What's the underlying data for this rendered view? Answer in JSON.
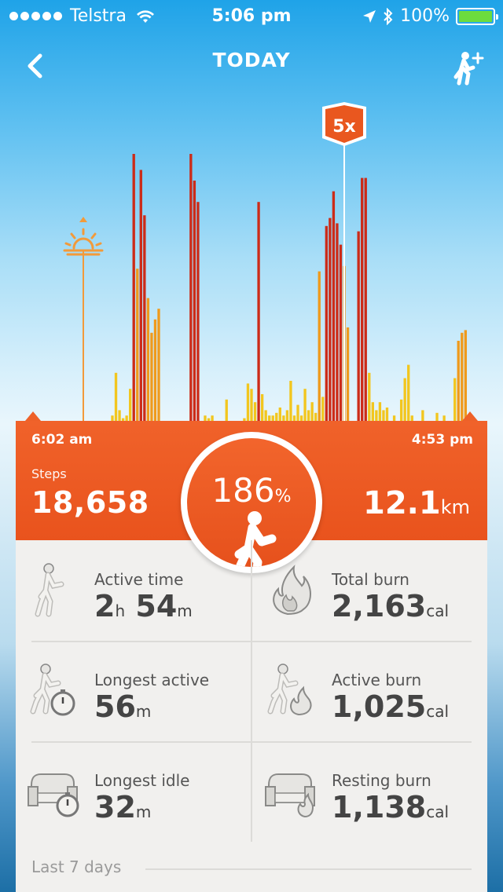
{
  "status_bar": {
    "carrier": "Telstra",
    "time": "5:06 pm",
    "battery": "100%",
    "battery_level": 1.0
  },
  "nav": {
    "title": "TODAY",
    "back_icon": "chevron-left-icon",
    "add_icon": "add-friend-icon"
  },
  "chart": {
    "sunrise_icon": "sunrise-icon",
    "multiplier_badge": "5x",
    "colors": {
      "high": "#cc2b18",
      "medium": "#ef9a1c",
      "low": "#f2c61e"
    }
  },
  "chart_data": {
    "type": "bar",
    "start": "6:02 am",
    "end": "4:53 pm",
    "values": [
      0,
      0,
      0,
      0,
      0,
      0,
      0,
      0,
      0,
      0,
      0,
      0,
      0,
      0,
      0,
      0,
      0,
      0,
      0,
      0,
      0,
      0,
      0,
      0,
      0,
      0,
      0,
      0,
      0,
      0,
      0,
      2,
      18,
      4,
      1,
      2,
      12,
      100,
      57,
      94,
      77,
      46,
      33,
      38,
      42,
      0,
      0,
      0,
      0,
      0,
      0,
      0,
      0,
      100,
      90,
      82,
      0,
      2,
      1,
      2,
      0,
      0,
      0,
      8,
      0,
      0,
      0,
      0,
      1,
      14,
      12,
      7,
      82,
      10,
      4,
      2,
      2,
      3,
      5,
      2,
      4,
      15,
      2,
      6,
      2,
      12,
      4,
      7,
      3,
      56,
      9,
      73,
      76,
      86,
      74,
      66,
      58,
      35,
      0,
      0,
      71,
      91,
      91,
      18,
      7,
      4,
      7,
      4,
      5,
      0,
      2,
      0,
      8,
      16,
      21,
      2,
      0,
      0,
      4,
      0,
      0,
      0,
      3,
      0,
      2,
      0,
      0,
      16,
      30,
      33,
      34,
      0,
      0,
      0,
      0,
      0,
      0,
      0,
      0,
      0,
      0
    ]
  },
  "summary": {
    "start_time": "6:02 am",
    "end_time": "4:53 pm",
    "steps_label": "Steps",
    "steps_value": "18,658",
    "goal_value": "186",
    "goal_unit": "%",
    "distance_value": "12.1",
    "distance_unit": "km"
  },
  "stats": [
    {
      "icon": "active-time-icon",
      "label": "Active time",
      "value_a": "2",
      "unit_a": "h",
      "value_b": "54",
      "unit_b": "m"
    },
    {
      "icon": "total-burn-icon",
      "label": "Total burn",
      "value_a": "2,163",
      "unit_a": "cal",
      "value_b": "",
      "unit_b": ""
    },
    {
      "icon": "longest-active-icon",
      "label": "Longest active",
      "value_a": "56",
      "unit_a": "m",
      "value_b": "",
      "unit_b": ""
    },
    {
      "icon": "active-burn-icon",
      "label": "Active burn",
      "value_a": "1,025",
      "unit_a": "cal",
      "value_b": "",
      "unit_b": ""
    },
    {
      "icon": "longest-idle-icon",
      "label": "Longest idle",
      "value_a": "32",
      "unit_a": "m",
      "value_b": "",
      "unit_b": ""
    },
    {
      "icon": "resting-burn-icon",
      "label": "Resting burn",
      "value_a": "1,138",
      "unit_a": "cal",
      "value_b": "",
      "unit_b": ""
    }
  ],
  "footer": {
    "last7_label": "Last 7 days"
  }
}
